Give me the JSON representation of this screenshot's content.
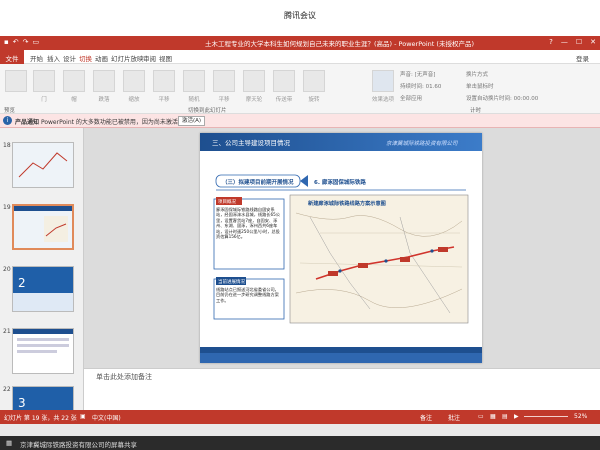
{
  "meeting": {
    "title": "腾讯会议"
  },
  "app": {
    "document_title": "土木工程专业的大学本科生如何规划自己未来的职业生涯？(高品) - PowerPoint (未授权产品)",
    "window_controls": [
      "?",
      "—",
      "☐",
      "✕"
    ]
  },
  "menu": {
    "file": "文件",
    "tabs": [
      "开始",
      "插入",
      "设计",
      "切换",
      "动画",
      "幻灯片放映",
      "审阅",
      "视图"
    ],
    "active_tab": "切换",
    "login": "登录"
  },
  "ribbon": {
    "preview_label": "预览",
    "group_label": "切换到此幻灯片",
    "timing_label": "计时",
    "effects_label": "效果选项",
    "transitions": [
      "门",
      "帽",
      "跌落",
      "缩放",
      "平移",
      "随机",
      "平移",
      "摩天轮",
      "传送带",
      "旋转"
    ],
    "sound": "声音: [无声音]",
    "duration": "持续时间: 01.60",
    "apply_all": "全部应用",
    "advance_title": "换片方式",
    "on_click": "单击鼠标时",
    "after": "设置自动换片时间: 00:00.00"
  },
  "notice": {
    "title": "产品通知",
    "text": "PowerPoint 的大多数功能已被禁用，因为尚未激活。",
    "button": "激活(A)"
  },
  "thumbnails": [
    {
      "num": "18",
      "selected": false
    },
    {
      "num": "19",
      "selected": true
    },
    {
      "num": "20",
      "selected": false
    },
    {
      "num": "21",
      "selected": false
    },
    {
      "num": "22",
      "selected": false
    }
  ],
  "slide": {
    "header": "三、公司主导建设项目情况",
    "company": "京津冀城际铁路投资有限公司",
    "section": "（三）拟建项目前期开展情况",
    "subsection": "6. 廊涿固保城际铁路",
    "map_title": "新建廊涿城际铁路线路方案示意图",
    "overview_label": "项目概况",
    "overview_text": "廊涿固保城际铁路线路自固安系站，经固涿涞水县城，线路长65公里，设置客货站7座，自固安、涿州、东湖、固涿，涿州西共6座车站，设计时速250公里/小时，总投资估算156亿。",
    "progress_label": "当前进展情况",
    "progress_text": "线路站点已报送河北省委省公司，目前仍在进一步研究调整线路方案工作。"
  },
  "notes": {
    "placeholder": "单击此处添加备注"
  },
  "status": {
    "slide_count": "幻灯片 第 19 张，共 22 张",
    "language": "中文(中国)",
    "notes_btn": "备注",
    "comments_btn": "批注",
    "zoom": "52%"
  },
  "share": {
    "text": "京津冀城际铁路投资有限公司的屏幕共享"
  }
}
